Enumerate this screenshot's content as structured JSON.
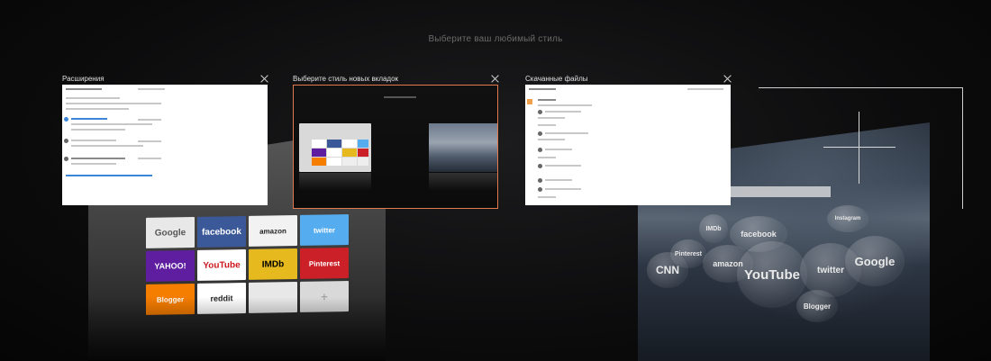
{
  "heading": "Выберите ваш любимый стиль",
  "tabs": [
    {
      "title": "Расширения",
      "state": "normal"
    },
    {
      "title": "Выберите стиль новых вкладок",
      "state": "selected"
    },
    {
      "title": "Скачанные файлы",
      "state": "normal"
    }
  ],
  "classic_tiles": [
    {
      "label": "Google",
      "kind": "light"
    },
    {
      "label": "facebook",
      "kind": "fb"
    },
    {
      "label": "amazon",
      "kind": "amazon"
    },
    {
      "label": "twitter",
      "kind": "twitter"
    },
    {
      "label": "YAHOO!",
      "kind": "yahoo"
    },
    {
      "label": "YouTube",
      "kind": "youtube"
    },
    {
      "label": "IMDb",
      "kind": "imdb"
    },
    {
      "label": "Pinterest",
      "kind": "pinterest"
    },
    {
      "label": "Blogger",
      "kind": "blogger"
    },
    {
      "label": "reddit",
      "kind": "reddit"
    },
    {
      "label": "",
      "kind": "light"
    },
    {
      "label": "+",
      "kind": "plus"
    }
  ],
  "visual_bubbles": {
    "imdb": "IMDb",
    "facebook": "facebook",
    "pinterest": "Pinterest",
    "cnn": "CNN",
    "amazon": "amazon",
    "youtube": "YouTube",
    "twitter": "twitter",
    "google": "Google",
    "blogger": "Blogger",
    "extra": "Instagram"
  },
  "colors": {
    "selected_border": "#e07b4d",
    "background": "#0c0c0d"
  },
  "icons": {
    "close": "close-icon",
    "add": "plus-icon"
  }
}
